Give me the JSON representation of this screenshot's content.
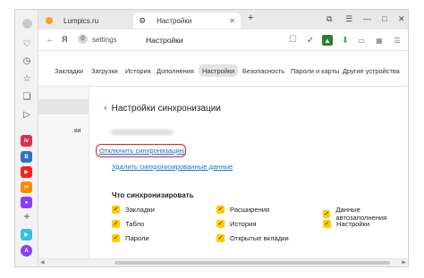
{
  "tabs": [
    {
      "label": "Lumpics.ru",
      "active": false
    },
    {
      "label": "Настройки",
      "active": true
    }
  ],
  "address": {
    "url": "settings",
    "title": "Настройки"
  },
  "settings_nav": [
    "Закладки",
    "Загрузки",
    "История",
    "Дополнения",
    "Настройки",
    "Безопасность",
    "Пароли и карты",
    "Другие устройства"
  ],
  "settings_nav_active": "Настройки",
  "side_panel_fragment": "ки",
  "sync": {
    "back_title": "Настройки синхронизации",
    "disable_link": "Отключить синхронизацию",
    "delete_link": "Удалить синхронизированные данные",
    "what_title": "Что синхронизировать",
    "options": {
      "bookmarks": "Закладки",
      "extensions": "Расширения",
      "autofill": "Данные автозаполнения",
      "tablo": "Табло",
      "history": "История",
      "settings": "Настройки",
      "passwords": "Пароли",
      "open_tabs": "Открытые вкладки"
    }
  },
  "colors": {
    "accent": "#ffcc00",
    "link": "#1a73c8",
    "highlight": "#e02020"
  }
}
